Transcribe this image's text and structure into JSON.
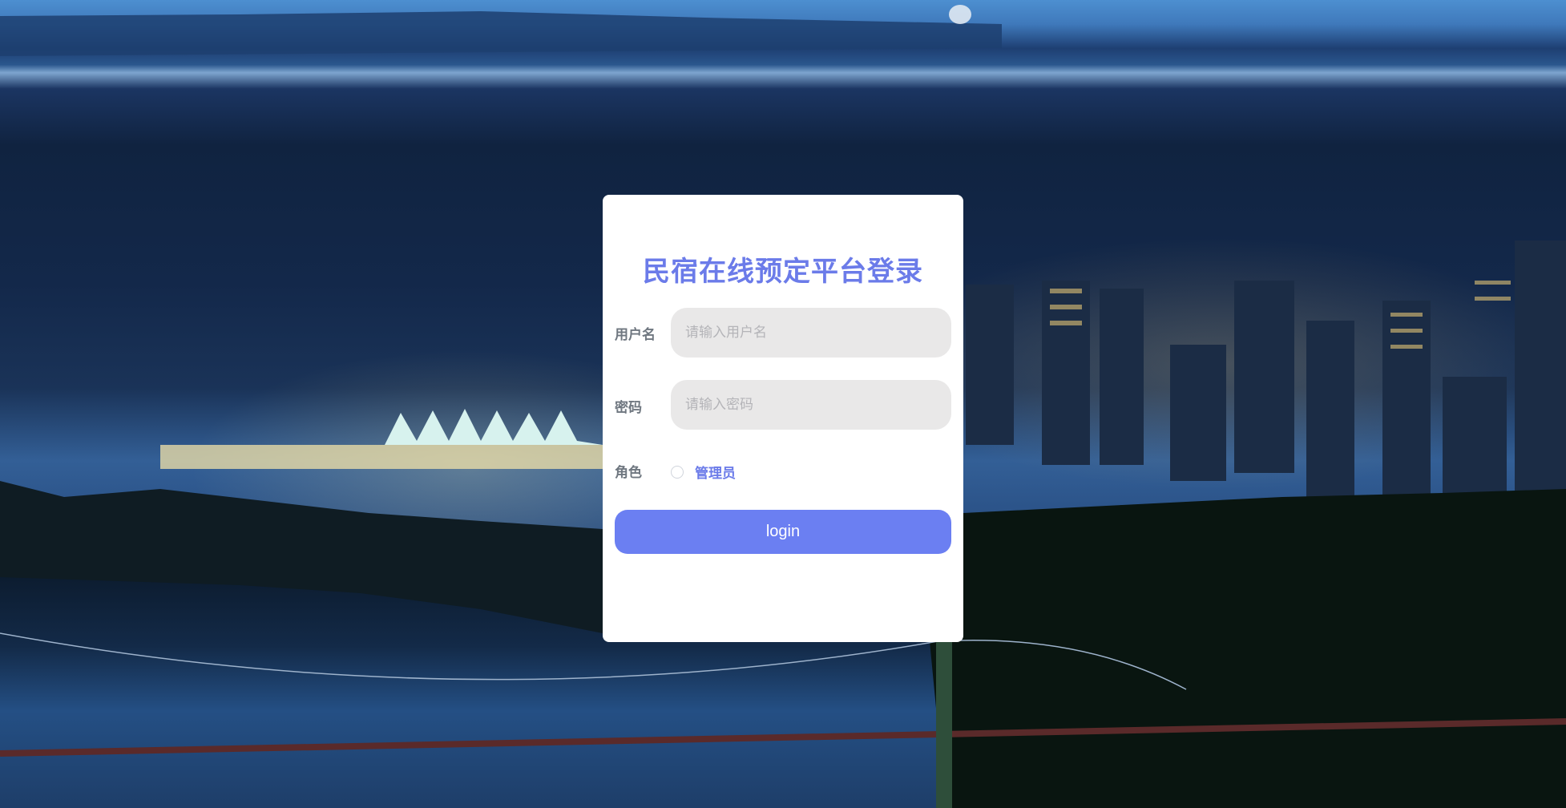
{
  "login": {
    "title": "民宿在线预定平台登录",
    "username_label": "用户名",
    "username_placeholder": "请输入用户名",
    "username_value": "",
    "password_label": "密码",
    "password_placeholder": "请输入密码",
    "password_value": "",
    "role_label": "角色",
    "role_options": [
      "管理员"
    ],
    "role_selected": null,
    "submit_label": "login"
  },
  "colors": {
    "accent": "#6b7be9",
    "button": "#6b7ff2",
    "input_bg": "#e9e8e8",
    "card_bg": "#ffffff"
  }
}
